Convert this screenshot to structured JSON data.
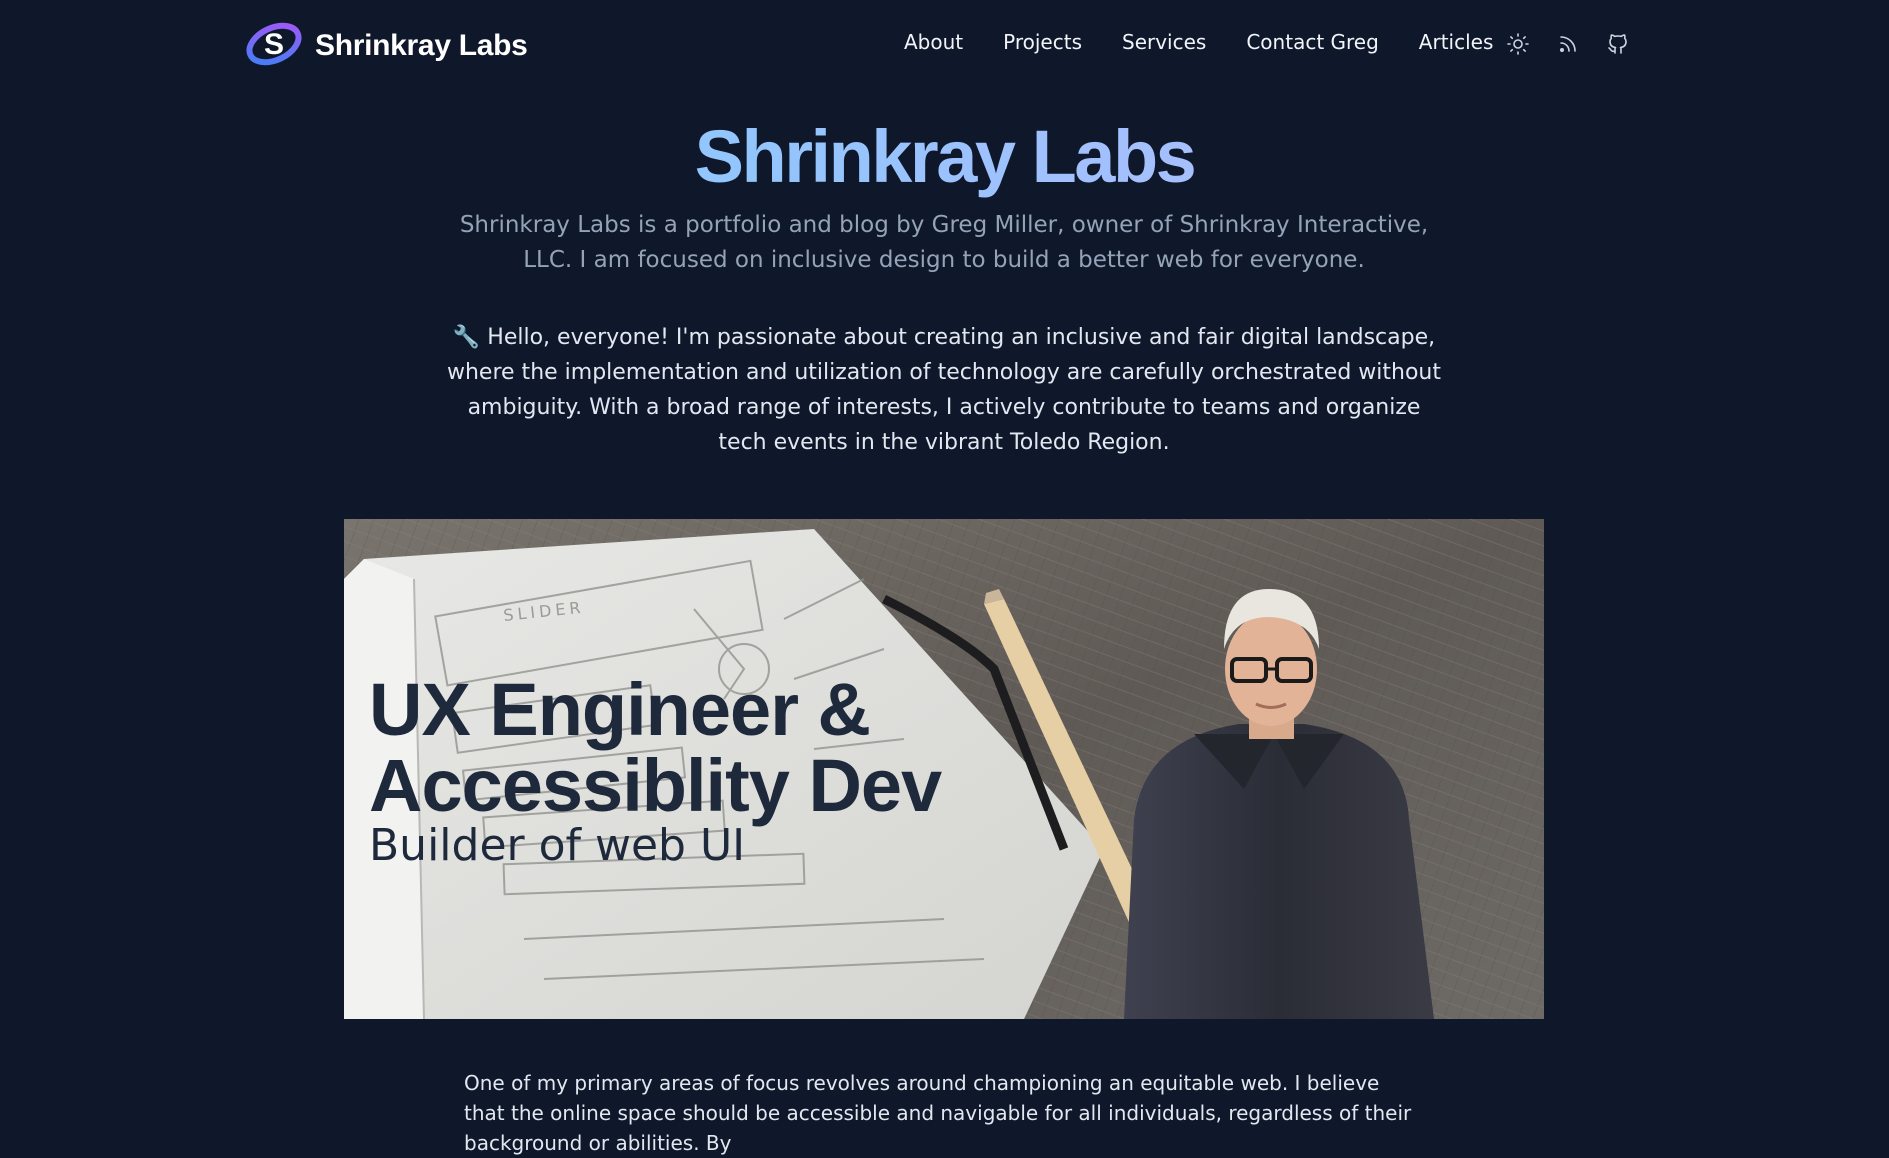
{
  "header": {
    "brand_name": "Shrinkray Labs",
    "logo_icon": "shrinkray-logo",
    "nav": [
      "About",
      "Projects",
      "Services",
      "Contact Greg",
      "Articles"
    ],
    "icons": [
      "sun-icon",
      "rss-icon",
      "github-icon"
    ]
  },
  "hero": {
    "title": "Shrinkray Labs",
    "tagline": "Shrinkray Labs is a portfolio and blog by Greg Miller, owner of Shrinkray Interactive, LLC. I am focused on inclusive design to build a better web for everyone.",
    "intro_icon": "🔧",
    "intro": "Hello, everyone! I'm passionate about creating an inclusive and fair digital landscape, where the implementation and utilization of technology are carefully orchestrated without ambiguity. With a broad range of interests, I actively contribute to teams and organize tech events in the vibrant Toledo Region."
  },
  "banner": {
    "headline_line1": "UX Engineer &",
    "headline_line2": "Accessiblity Dev",
    "subheadline": "Builder of web UI",
    "sketch_label": "SLIDER"
  },
  "body": {
    "paragraph": "One of my primary areas of focus revolves around championing an equitable web. I believe that the online space should be accessible and navigable for all individuals, regardless of their background or abilities. By"
  },
  "colors": {
    "background": "#0f172a",
    "title_gradient_start": "#7dd3fc",
    "title_gradient_end": "#c4b5fd",
    "muted_text": "#94a3b8"
  }
}
